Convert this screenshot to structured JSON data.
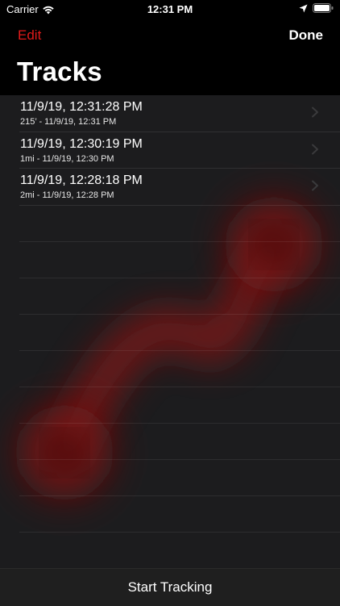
{
  "status_bar": {
    "carrier": "Carrier",
    "time": "12:31 PM",
    "wifi_icon": "wifi-icon",
    "location_icon": "location-arrow-icon",
    "battery_icon": "battery-icon"
  },
  "nav": {
    "edit_label": "Edit",
    "done_label": "Done",
    "accent_color": "#e01a1a"
  },
  "title": "Tracks",
  "tracks": [
    {
      "title": "11/9/19, 12:31:28 PM",
      "subtitle": "215’ - 11/9/19, 12:31 PM"
    },
    {
      "title": "11/9/19, 12:30:19 PM",
      "subtitle": "1mi - 11/9/19, 12:30 PM"
    },
    {
      "title": "11/9/19, 12:28:18 PM",
      "subtitle": "2mi - 11/9/19, 12:28 PM"
    }
  ],
  "toolbar": {
    "start_label": "Start Tracking"
  }
}
